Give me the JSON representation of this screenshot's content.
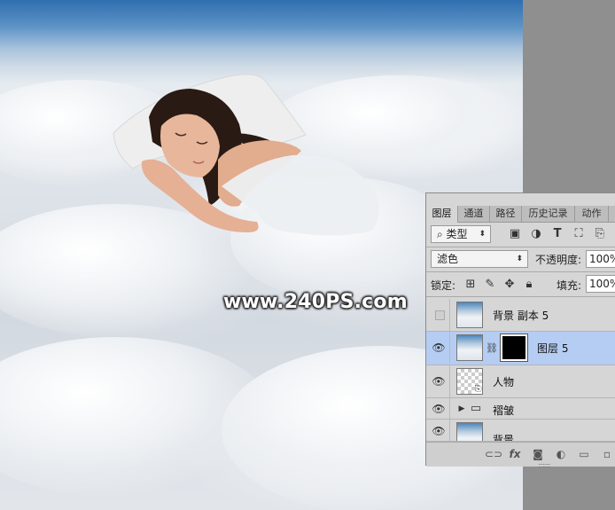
{
  "watermark": "www.240PS.com",
  "layers_panel": {
    "tabs": [
      "图层",
      "通道",
      "路径",
      "历史记录",
      "动作"
    ],
    "filter": {
      "value": "类型"
    },
    "filter_icons": [
      "image-filter-icon",
      "adjustment-filter-icon",
      "type-filter-icon",
      "shape-filter-icon",
      "smart-object-filter-icon"
    ],
    "blend_mode": "滤色",
    "opacity_label": "不透明度:",
    "opacity_value": "100%",
    "lock_label": "锁定:",
    "fill_label": "填充:",
    "fill_value": "100%",
    "layers": [
      {
        "name": "背景 副本 5",
        "visible": false
      },
      {
        "name": "图层 5",
        "visible": true,
        "selected": true,
        "has_mask": true
      },
      {
        "name": "人物",
        "visible": true,
        "smart_object": true
      },
      {
        "name": "褶皱",
        "visible": true,
        "group": true
      },
      {
        "name": "背景",
        "visible": true
      }
    ],
    "footer_icons": [
      "link-icon",
      "fx-icon",
      "mask-icon",
      "adjustment-icon",
      "folder-icon",
      "new-layer-icon"
    ]
  },
  "colors": {
    "selected_row": "#b6cdf3",
    "panel_bg": "#d6d6d6",
    "workspace_gray": "#8f8f8f"
  }
}
